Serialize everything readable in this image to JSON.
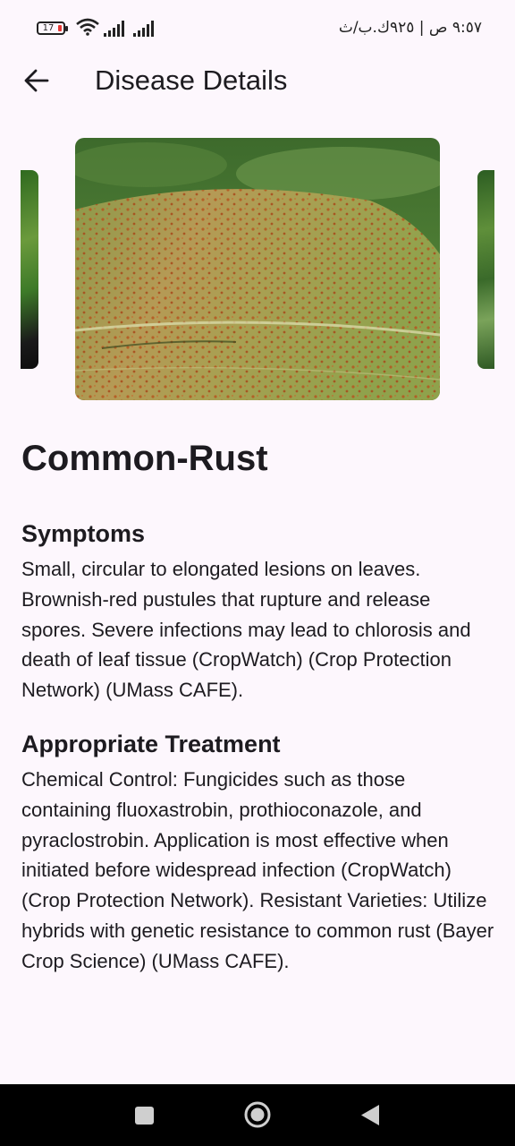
{
  "status_bar": {
    "battery_level": "17",
    "time_text": "٩:٥٧ ص | ٩٢٥ك.ب/ث"
  },
  "app_bar": {
    "title": "Disease Details",
    "back_icon": "arrow-left-icon"
  },
  "carousel": {
    "images": [
      "corn-leaf-thumbnail",
      "common-rust-leaf-photo",
      "corn-leaf-thumbnail"
    ]
  },
  "disease": {
    "name": "Common-Rust",
    "symptoms_title": "Symptoms",
    "symptoms_text": "Small, circular to elongated lesions on leaves. Brownish-red pustules that rupture and release spores. Severe infections may lead to chlorosis and death of leaf tissue (CropWatch) (Crop Protection Network) (UMass CAFE).",
    "treatment_title": "Appropriate Treatment",
    "treatment_text": "Chemical Control: Fungicides such as those containing fluoxastrobin, prothioconazole, and pyraclostrobin. Application is most effective when initiated before widespread infection (CropWatch) (Crop Protection Network). Resistant Varieties: Utilize hybrids with genetic resistance to common rust (Bayer Crop Science) (UMass CAFE)."
  },
  "nav_bar": {
    "recents_icon": "square-icon",
    "home_icon": "circle-icon",
    "back_icon": "triangle-back-icon"
  }
}
